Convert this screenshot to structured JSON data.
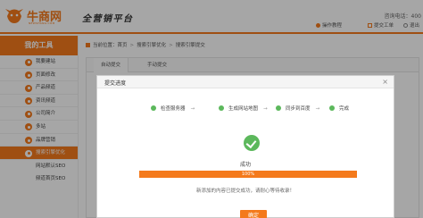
{
  "header": {
    "logo_text": "牛商网",
    "logo_sub": "NEWSHANG.COM",
    "slogan": "全营销平台",
    "phone": "咨询电话：400",
    "links": [
      {
        "label": "操作教程",
        "icon": "play-icon"
      },
      {
        "label": "提交工单",
        "icon": "ticket-icon"
      },
      {
        "label": "退出",
        "icon": "logout-icon"
      }
    ]
  },
  "sidebar": {
    "title": "我的工具",
    "items": [
      {
        "label": "我要建站",
        "active": false
      },
      {
        "label": "页面修改",
        "active": false
      },
      {
        "label": "产品频道",
        "active": false
      },
      {
        "label": "资讯频道",
        "active": false
      },
      {
        "label": "公司简介",
        "active": false
      },
      {
        "label": "多站",
        "active": false
      },
      {
        "label": "品牌营销",
        "active": false
      },
      {
        "label": "搜索引擎优化",
        "active": true
      }
    ],
    "subitems": [
      "网站默认SEO",
      "频道首页SEO"
    ]
  },
  "breadcrumb": {
    "prefix": "当前位置：",
    "items": [
      "首页",
      "搜索引擎优化",
      "搜索引擎提交"
    ]
  },
  "panel": {
    "tabs": [
      "自动提交",
      "手动提交"
    ],
    "line1": "当天",
    "line2": "以下",
    "footer": "详细"
  },
  "modal": {
    "title": "提交进度",
    "close": "×",
    "steps": [
      {
        "label": "检查服务器",
        "arrow": "→"
      },
      {
        "label": "生成网站地图",
        "arrow": "→"
      },
      {
        "label": "同步到百度",
        "arrow": "→"
      },
      {
        "label": "完成",
        "arrow": ""
      }
    ],
    "status": "成功",
    "progress_percent": 100,
    "progress_label": "100%",
    "note": "新添加的内容已提交成功，请耐心等待收录！",
    "confirm_label": "确定",
    "colors": {
      "accent": "#f47a1c",
      "success": "#5cb85c"
    }
  }
}
